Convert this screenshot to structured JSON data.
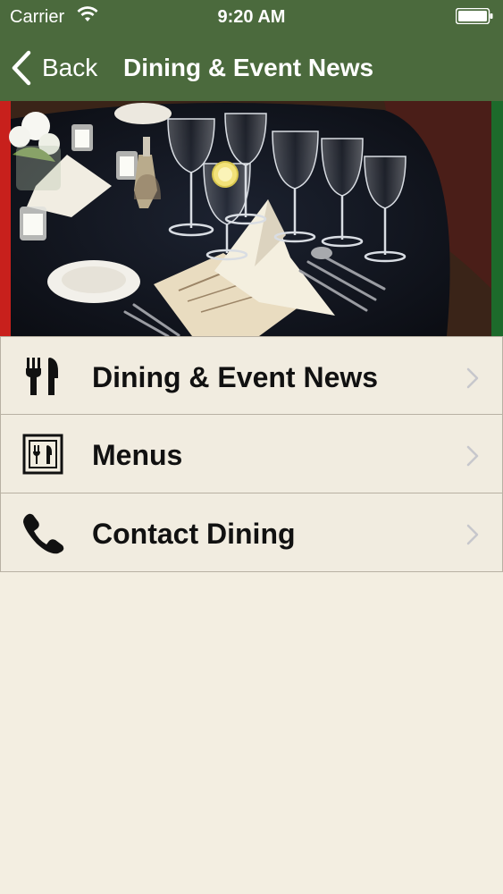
{
  "status_bar": {
    "carrier": "Carrier",
    "time": "9:20 AM"
  },
  "nav": {
    "back_label": "Back",
    "title": "Dining & Event News"
  },
  "colors": {
    "header": "#4b6a3d",
    "background": "#f3eee1",
    "chevron": "#c7c7cc"
  },
  "menu": {
    "items": [
      {
        "label": "Dining & Event News",
        "icon": "fork-knife-icon"
      },
      {
        "label": "Menus",
        "icon": "menu-card-icon"
      },
      {
        "label": "Contact Dining",
        "icon": "phone-icon"
      }
    ]
  }
}
